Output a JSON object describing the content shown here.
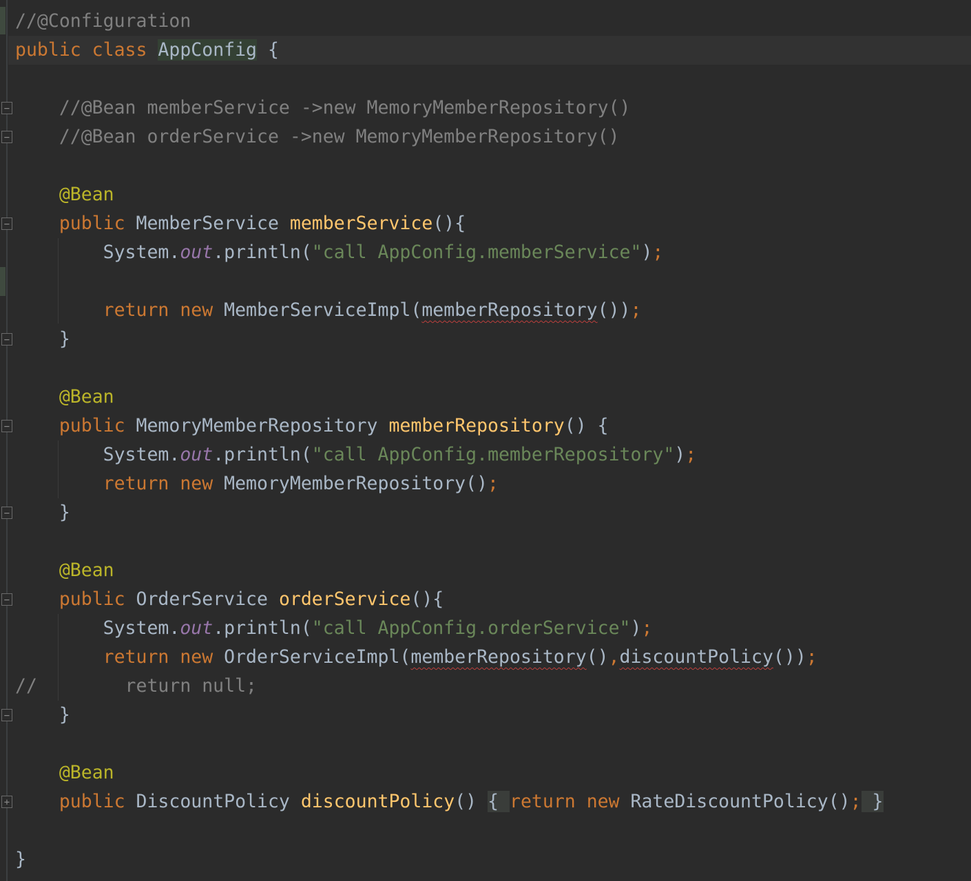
{
  "editor": {
    "language": "java",
    "colors": {
      "background": "#2b2b2b",
      "keyword": "#cc7832",
      "comment": "#808080",
      "annotation": "#bbb529",
      "string": "#6a8759",
      "method": "#ffc66d",
      "text": "#a9b7c6"
    },
    "lines": [
      [
        [
          "//@Configuration",
          "cm"
        ]
      ],
      [
        [
          "public class ",
          "kw"
        ],
        [
          "AppConfig",
          "hl"
        ],
        [
          " {",
          "df"
        ]
      ],
      [],
      [
        [
          "    //@Bean memberService ->new MemoryMemberRepository()",
          "cm"
        ]
      ],
      [
        [
          "    //@Bean orderService ->new MemoryMemberRepository()",
          "cm"
        ]
      ],
      [],
      [
        [
          "    ",
          "df"
        ],
        [
          "@Bean",
          "an"
        ]
      ],
      [
        [
          "    ",
          "df"
        ],
        [
          "public ",
          "kw"
        ],
        [
          "MemberService ",
          "df"
        ],
        [
          "memberService",
          "fn"
        ],
        [
          "(){",
          "df"
        ]
      ],
      [
        [
          "        System.",
          "df"
        ],
        [
          "out",
          "sf"
        ],
        [
          ".println(",
          "df"
        ],
        [
          "\"call AppConfig.memberService\"",
          "st"
        ],
        [
          ")",
          "df"
        ],
        [
          ";",
          "kw"
        ]
      ],
      [],
      [
        [
          "        ",
          "df"
        ],
        [
          "return new ",
          "kw"
        ],
        [
          "MemberServiceImpl(",
          "df"
        ],
        [
          "memberRepository",
          "err"
        ],
        [
          "())",
          "df"
        ],
        [
          ";",
          "kw"
        ]
      ],
      [
        [
          "    }",
          "df"
        ]
      ],
      [],
      [
        [
          "    ",
          "df"
        ],
        [
          "@Bean",
          "an"
        ]
      ],
      [
        [
          "    ",
          "df"
        ],
        [
          "public ",
          "kw"
        ],
        [
          "MemoryMemberRepository ",
          "df"
        ],
        [
          "memberRepository",
          "fn"
        ],
        [
          "() {",
          "df"
        ]
      ],
      [
        [
          "        System.",
          "df"
        ],
        [
          "out",
          "sf"
        ],
        [
          ".println(",
          "df"
        ],
        [
          "\"call AppConfig.memberRepository\"",
          "st"
        ],
        [
          ")",
          "df"
        ],
        [
          ";",
          "kw"
        ]
      ],
      [
        [
          "        ",
          "df"
        ],
        [
          "return new ",
          "kw"
        ],
        [
          "MemoryMemberRepository()",
          "df"
        ],
        [
          ";",
          "kw"
        ]
      ],
      [
        [
          "    }",
          "df"
        ]
      ],
      [],
      [
        [
          "    ",
          "df"
        ],
        [
          "@Bean",
          "an"
        ]
      ],
      [
        [
          "    ",
          "df"
        ],
        [
          "public ",
          "kw"
        ],
        [
          "OrderService ",
          "df"
        ],
        [
          "orderService",
          "fn"
        ],
        [
          "(){",
          "df"
        ]
      ],
      [
        [
          "        System.",
          "df"
        ],
        [
          "out",
          "sf"
        ],
        [
          ".println(",
          "df"
        ],
        [
          "\"call AppConfig.orderService\"",
          "st"
        ],
        [
          ")",
          "df"
        ],
        [
          ";",
          "kw"
        ]
      ],
      [
        [
          "        ",
          "df"
        ],
        [
          "return new ",
          "kw"
        ],
        [
          "OrderServiceImpl(",
          "df"
        ],
        [
          "memberRepository",
          "err"
        ],
        [
          "()",
          "df"
        ],
        [
          ",",
          "kw"
        ],
        [
          "discountPolicy",
          "err"
        ],
        [
          "())",
          "df"
        ],
        [
          ";",
          "kw"
        ]
      ],
      [
        [
          "//        return null;",
          "cm"
        ]
      ],
      [
        [
          "    }",
          "df"
        ]
      ],
      [],
      [
        [
          "    ",
          "df"
        ],
        [
          "@Bean",
          "an"
        ]
      ],
      [
        [
          "    ",
          "df"
        ],
        [
          "public ",
          "kw"
        ],
        [
          "DiscountPolicy ",
          "df"
        ],
        [
          "discountPolicy",
          "fn"
        ],
        [
          "() ",
          "df"
        ],
        [
          "{ ",
          "fd"
        ],
        [
          "return new ",
          "kw"
        ],
        [
          "RateDiscountPolicy()",
          "df"
        ],
        [
          ";",
          "kw"
        ],
        [
          " }",
          "fd"
        ]
      ],
      [],
      [
        [
          "}",
          "df"
        ]
      ]
    ],
    "fold_markers": [
      {
        "line": 3,
        "type": "start"
      },
      {
        "line": 4,
        "type": "end"
      },
      {
        "line": 7,
        "type": "start"
      },
      {
        "line": 11,
        "type": "end"
      },
      {
        "line": 14,
        "type": "start"
      },
      {
        "line": 17,
        "type": "end"
      },
      {
        "line": 20,
        "type": "start"
      },
      {
        "line": 24,
        "type": "end"
      },
      {
        "line": 27,
        "type": "collapsed"
      }
    ],
    "current_line": 1
  }
}
